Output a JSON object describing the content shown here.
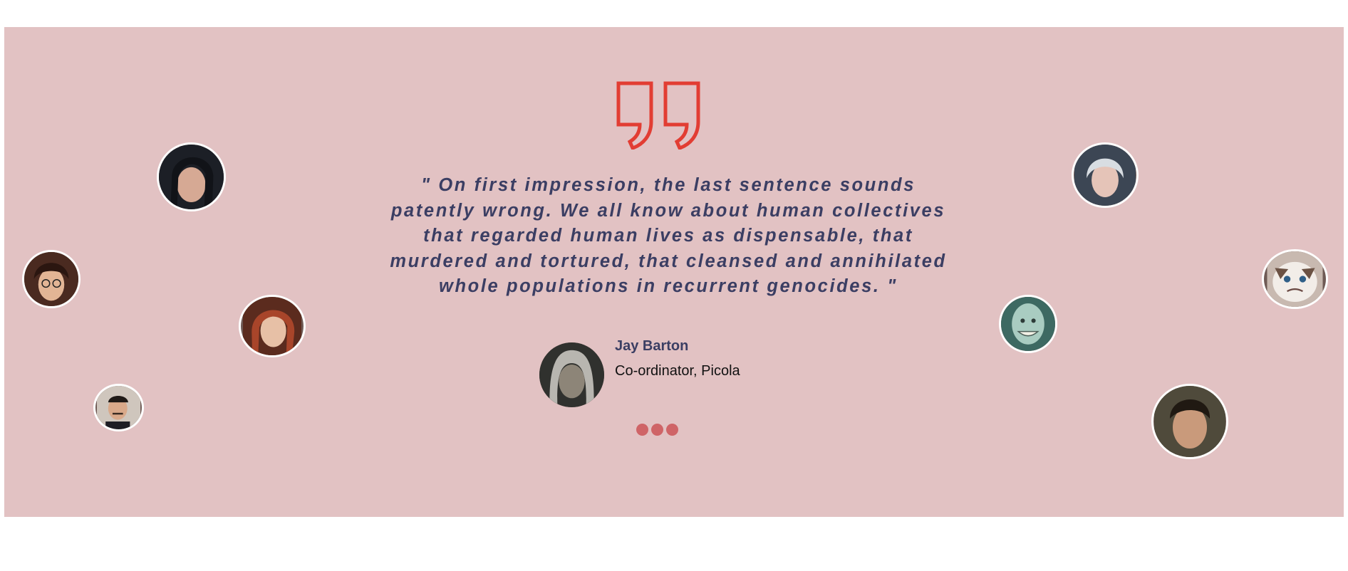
{
  "testimonial": {
    "quote": "\" On first impression, the last sentence sounds patently wrong. We all know about human collectives that regarded human lives as dispensable, that murdered and tortured, that cleansed and annihilated whole populations in recurrent genocides. \"",
    "author_name": "Jay Barton",
    "author_role": "Co-ordinator, Picola",
    "quote_icon": "closing-quote-icon"
  },
  "pagination": {
    "dot_count": 3
  },
  "colors": {
    "panel_background": "#e2c2c3",
    "quote_icon": "#e23d33",
    "quote_text": "#3b3e63",
    "author_name": "#3b3e63",
    "dot": "#cf6467",
    "avatar_border": "#ffffff"
  }
}
